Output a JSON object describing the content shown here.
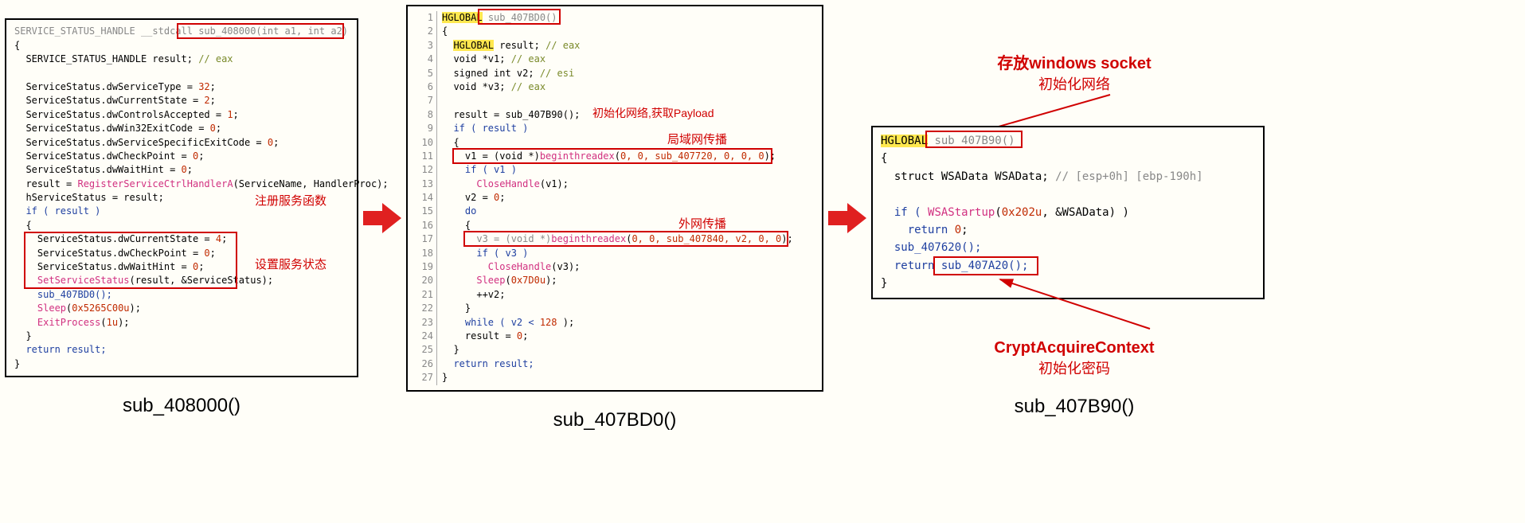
{
  "panel1": {
    "caption": "sub_408000()",
    "annot_register": "注册服务函数",
    "annot_setstate": "设置服务状态"
  },
  "panel2": {
    "caption": "sub_407BD0()",
    "annot_initnet": "初始化网络,获取Payload",
    "annot_lan": "局域网传播",
    "annot_wan": "外网传播"
  },
  "panel3": {
    "caption": "sub_407B90()",
    "annot_wsock_bold": "存放windows socket",
    "annot_wsock_sub": "初始化网络",
    "annot_crypt_bold": "CryptAcquireContext",
    "annot_crypt_sub": "初始化密码"
  },
  "code1": {
    "sig_pre": "SERVICE_STATUS_HANDLE __stdcall ",
    "sig_fn": "sub_408000(int a1, int a2)",
    "decl_result": "  SERVICE_STATUS_HANDLE result; ",
    "decl_result_cm": "// eax",
    "l5": "  ServiceStatus.dwServiceType = ",
    "l5n": "32",
    "l6": "  ServiceStatus.dwCurrentState = ",
    "l6n": "2",
    "l7": "  ServiceStatus.dwControlsAccepted = ",
    "l7n": "1",
    "l8": "  ServiceStatus.dwWin32ExitCode = ",
    "l8n": "0",
    "l9": "  ServiceStatus.dwServiceSpecificExitCode = ",
    "l9n": "0",
    "l10": "  ServiceStatus.dwCheckPoint = ",
    "l10n": "0",
    "l11": "  ServiceStatus.dwWaitHint = ",
    "l11n": "0",
    "l12a": "  result = ",
    "l12b": "RegisterServiceCtrlHandlerA",
    "l12c": "(ServiceName, HandlerProc);",
    "l13": "  hServiceStatus = result;",
    "l14": "  if ( result )",
    "l16": "    ServiceStatus.dwCurrentState = ",
    "l16n": "4",
    "l17": "    ServiceStatus.dwCheckPoint = ",
    "l17n": "0",
    "l18": "    ServiceStatus.dwWaitHint = ",
    "l18n": "0",
    "l19a": "    ",
    "l19b": "SetServiceStatus",
    "l19c": "(result, &ServiceStatus);",
    "l20": "    sub_407BD0();",
    "l21a": "    ",
    "l21b": "Sleep",
    "l21c": "(",
    "l21n": "0x5265C00u",
    "l21d": ");",
    "l22a": "    ",
    "l22b": "ExitProcess",
    "l22c": "(",
    "l22n": "1u",
    "l22d": ");",
    "l24": "  return result;"
  },
  "code2": {
    "ln1": "1",
    "ln2": "2",
    "ln3": "3",
    "ln4": "4",
    "ln5": "5",
    "ln6": "6",
    "ln7": "7",
    "ln8": "8",
    "ln9": "9",
    "ln10": "10",
    "ln11": "11",
    "ln12": "12",
    "ln13": "13",
    "ln14": "14",
    "ln15": "15",
    "ln16": "16",
    "ln17": "17",
    "ln18": "18",
    "ln19": "19",
    "ln20": "20",
    "ln21": "21",
    "ln22": "22",
    "ln23": "23",
    "ln24": "24",
    "ln25": "25",
    "ln26": "26",
    "ln27": "27",
    "hglobal": "HGLOBAL",
    "sig_fn": "sub_407BD0()",
    "d3": " result; ",
    "d3cm": "// eax",
    "d4": "  void *v1; ",
    "d4cm": "// eax",
    "d5": "  signed int v2; ",
    "d5cm": "// esi",
    "d6": "  void *v3; ",
    "d6cm": "// eax",
    "l8": "  result = sub_407B90();",
    "l9": "  if ( result )",
    "l11a": "    v1 = (void *)",
    "l11b": "beginthreadex",
    "l11c": "(",
    "l11n": "0, 0, sub_407720, 0, 0, 0",
    "l11d": ");",
    "l12": "    if ( v1 )",
    "l13a": "      ",
    "l13b": "CloseHandle",
    "l13c": "(v1);",
    "l14": "    v2 = ",
    "l14n": "0",
    "l15": "    do",
    "l17a": "      v3 = (void *)",
    "l17b": "beginthreadex",
    "l17c": "(",
    "l17n": "0, 0, sub_407840, v2, 0, 0",
    "l17d": ");",
    "l18": "      if ( v3 )",
    "l19a": "        ",
    "l19b": "CloseHandle",
    "l19c": "(v3);",
    "l20a": "      ",
    "l20b": "Sleep",
    "l20c": "(",
    "l20n": "0x7D0u",
    "l20d": ");",
    "l21": "      ++v2;",
    "l23": "    while ( v2 < ",
    "l23n": "128",
    "l23b": " );",
    "l24": "    result = ",
    "l24n": "0",
    "l26": "  return result;"
  },
  "code3": {
    "hglobal": "HGLOBAL",
    "sig_fn": " sub_407B90()",
    "d3": "  struct WSAData WSAData; ",
    "d3cm": "// [esp+0h] [ebp-190h]",
    "l5a": "  if ( ",
    "l5b": "WSAStartup",
    "l5c": "(",
    "l5n": "0x202u",
    "l5d": ", &WSAData) )",
    "l6": "    return ",
    "l6n": "0",
    "l7": "  sub_407620();",
    "l8a": "  return ",
    "l8b": "sub_407A20();"
  }
}
